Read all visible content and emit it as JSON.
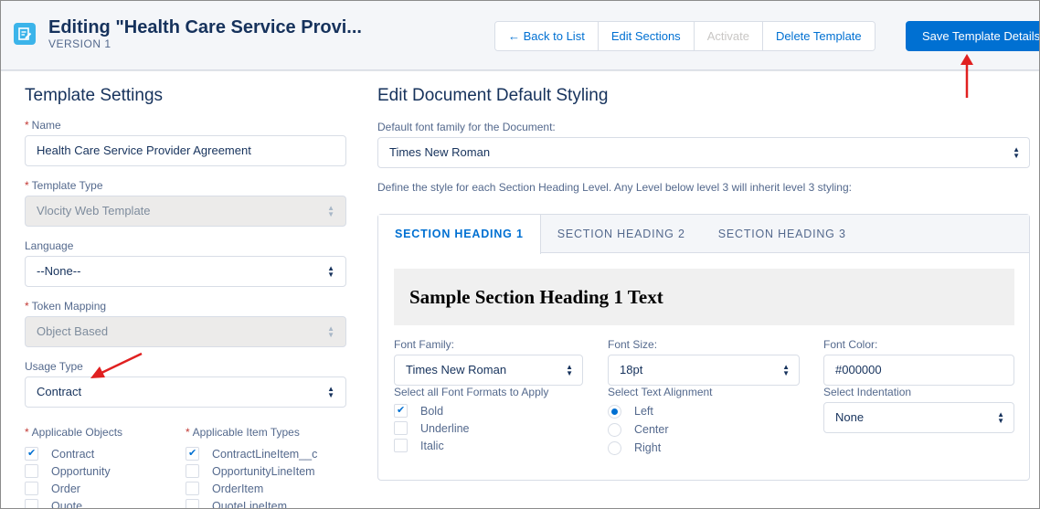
{
  "header": {
    "title": "Editing \"Health Care Service Provi...",
    "subtitle": "VERSION 1",
    "buttons": {
      "back": "←  Back to List",
      "edit_sections": "Edit Sections",
      "activate": "Activate",
      "delete": "Delete Template",
      "save": "Save Template Details"
    }
  },
  "template_settings": {
    "heading": "Template Settings",
    "name_label": "Name",
    "name_value": "Health Care Service Provider Agreement",
    "type_label": "Template Type",
    "type_value": "Vlocity Web Template",
    "language_label": "Language",
    "language_value": "--None--",
    "token_label": "Token Mapping",
    "token_value": "Object Based",
    "usage_label": "Usage Type",
    "usage_value": "Contract",
    "objects_label": "Applicable Objects",
    "objects": [
      {
        "label": "Contract",
        "checked": true
      },
      {
        "label": "Opportunity",
        "checked": false
      },
      {
        "label": "Order",
        "checked": false
      },
      {
        "label": "Quote",
        "checked": false
      }
    ],
    "item_types_label": "Applicable Item Types",
    "item_types": [
      {
        "label": "ContractLineItem__c",
        "checked": true
      },
      {
        "label": "OpportunityLineItem",
        "checked": false
      },
      {
        "label": "OrderItem",
        "checked": false
      },
      {
        "label": "QuoteLineItem",
        "checked": false
      }
    ]
  },
  "styling": {
    "heading": "Edit Document Default Styling",
    "font_family_label": "Default font family for the Document:",
    "font_family_value": "Times New Roman",
    "section_hint": "Define the style for each Section Heading Level. Any Level below level 3 will inherit level 3 styling:",
    "tabs": [
      "SECTION HEADING 1",
      "SECTION HEADING 2",
      "SECTION HEADING 3"
    ],
    "sample_text": "Sample Section Heading 1 Text",
    "font_family_field_label": "Font Family:",
    "font_family_field_value": "Times New Roman",
    "font_size_label": "Font Size:",
    "font_size_value": "18pt",
    "font_color_label": "Font Color:",
    "font_color_value": "#000000",
    "formats_label": "Select all Font Formats to Apply",
    "formats": [
      {
        "label": "Bold",
        "checked": true
      },
      {
        "label": "Underline",
        "checked": false
      },
      {
        "label": "Italic",
        "checked": false
      }
    ],
    "alignment_label": "Select Text Alignment",
    "alignments": [
      {
        "label": "Left",
        "selected": true
      },
      {
        "label": "Center",
        "selected": false
      },
      {
        "label": "Right",
        "selected": false
      }
    ],
    "indent_label": "Select Indentation",
    "indent_value": "None"
  }
}
